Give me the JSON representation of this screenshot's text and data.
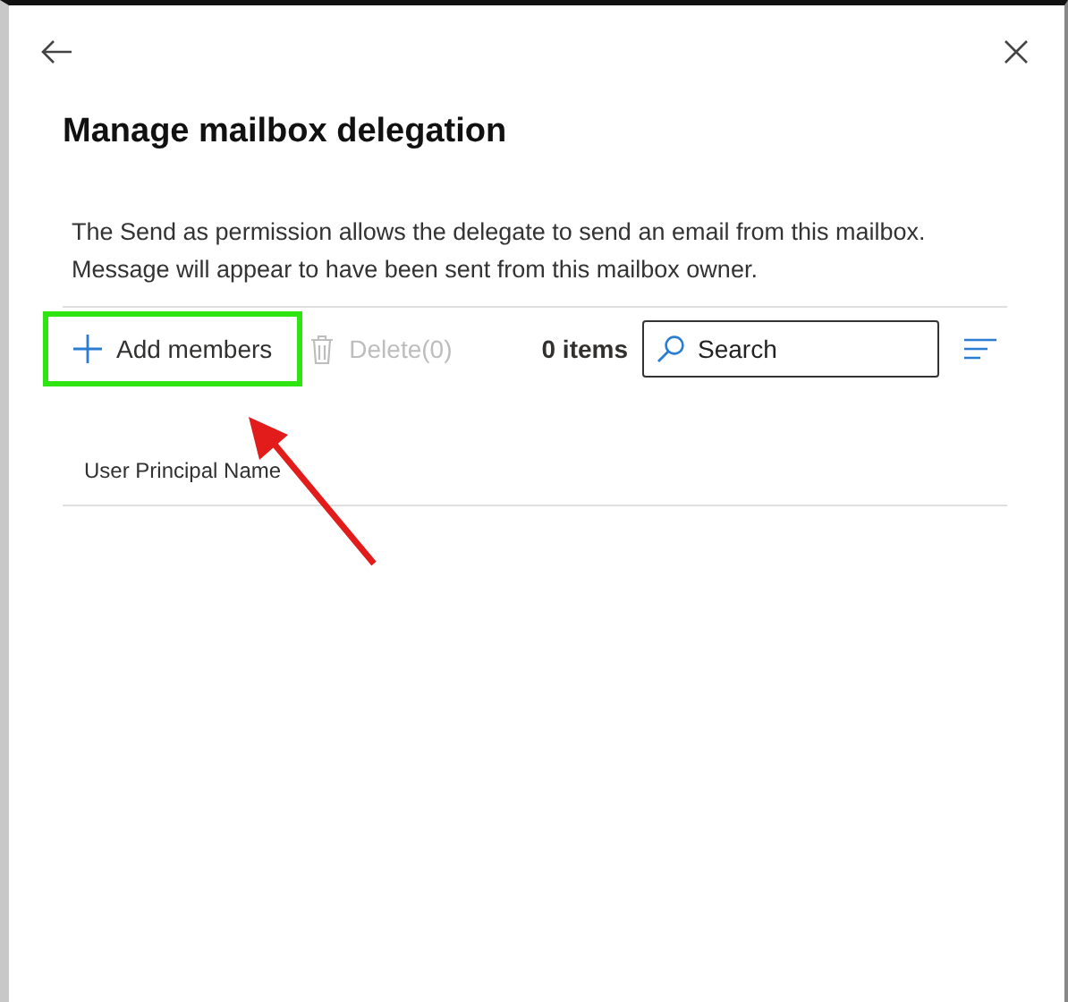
{
  "panel": {
    "title": "Manage mailbox delegation",
    "description": "The Send as permission allows the delegate to send an email from this mailbox. Message will appear to have been sent from this mailbox owner."
  },
  "toolbar": {
    "add_button": {
      "label": "Add members",
      "highlighted": true
    },
    "delete_button": {
      "label": "Delete(0)",
      "disabled": true
    },
    "item_count": "0 items",
    "search": {
      "placeholder": "Search"
    }
  },
  "table": {
    "columns": [
      "User Principal Name"
    ]
  }
}
